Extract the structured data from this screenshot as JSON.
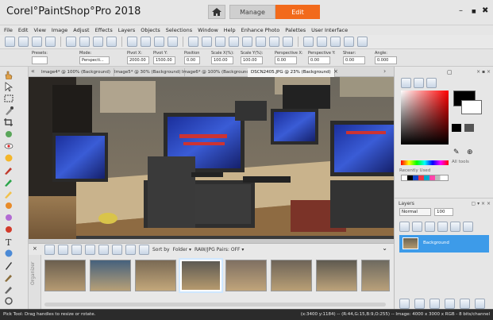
{
  "app": {
    "title": "Corel°PaintShop°Pro 2018"
  },
  "workspace_tabs": {
    "manage": "Manage",
    "edit": "Edit"
  },
  "window_controls": {
    "minimize": "–",
    "maximize": "■",
    "close": "✖"
  },
  "menu": [
    "File",
    "Edit",
    "View",
    "Image",
    "Adjust",
    "Effects",
    "Layers",
    "Objects",
    "Selections",
    "Window",
    "Help",
    "Enhance Photo",
    "Palettes",
    "User Interface"
  ],
  "tool_options": {
    "presets_label": "Presets:",
    "mode_label": "Mode:",
    "mode_value": "Perspecti...",
    "pivot_x_label": "Pivot X:",
    "pivot_x_value": "2000.00",
    "pivot_y_label": "Pivot Y:",
    "pivot_y_value": "1500.00",
    "position_label": "Position",
    "position_value": "0.00",
    "scale_x_label": "Scale X(%):",
    "scale_x_value": "100.00",
    "scale_y_label": "Scale Y(%):",
    "scale_y_value": "100.00",
    "persp_label": "Perspective X:",
    "persp_value": "0.00",
    "persp_y_label": "Perspective Y:",
    "persp_y_value": "0.00",
    "shear_label": "Shear:",
    "shear_value": "0.00",
    "angle_label": "Angle:",
    "angle_value": "0.000"
  },
  "doc_tabs": [
    "Image4* @ 100% (Background)",
    "Image5* @ 30% (Background)",
    "Image6* @ 100% (Background)",
    "DSCN2405.JPG @ 23% (Background)"
  ],
  "doc_tab_close": "×",
  "organizer": {
    "sort_label": "Sort by",
    "folder_label": "Folder ▾",
    "raw_label": "RAW/JPG Pairs: OFF ▾",
    "side_label": "Organizer"
  },
  "materials": {
    "title": "Materials",
    "all_tools": "All tools",
    "recently_used": "Recently Used"
  },
  "layers": {
    "title": "Layers",
    "blend_mode": "Normal",
    "opacity": "100",
    "layer_name": "Background"
  },
  "status": {
    "left": "Pick Tool: Drag handles to resize or rotate.",
    "right": "(x:3400 y:1184) -- (R:44,G:15,B:9,O:255) -- Image: 4000 x 3000 x RGB - 8 bits/channel"
  },
  "colors": {
    "accent": "#f26a1b",
    "selection": "#3d9be9",
    "status_bg": "#2b2b2b"
  }
}
